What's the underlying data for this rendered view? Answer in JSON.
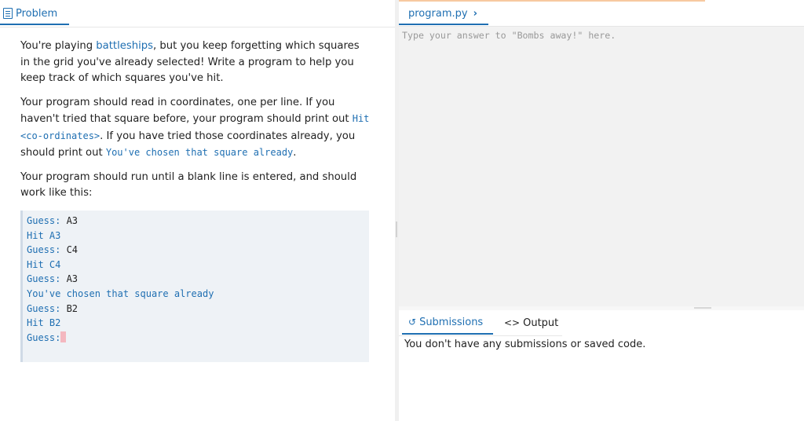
{
  "problem_tab": {
    "label": "Problem",
    "icon": "document-icon"
  },
  "problem": {
    "p1_before": "You're playing ",
    "p1_link": "battleships",
    "p1_after": ", but you keep forgetting which squares in the grid you've already selected! Write a program to help you keep track of which squares you've hit.",
    "p2_part1": "Your program should read in coordinates, one per line. If you haven't tried that square before, your program should print out ",
    "p2_code1": "Hit <co-ordinates>",
    "p2_part2": ". If you have tried those coordinates already, you should print out ",
    "p2_code2": "You've chosen that square already",
    "p2_part3": ".",
    "p3": "Your program should run until a blank line is entered, and should work like this:"
  },
  "sample_lines": [
    {
      "prompt": "Guess: ",
      "input": "A3"
    },
    {
      "prompt": "Hit A3",
      "input": ""
    },
    {
      "prompt": "Guess: ",
      "input": "C4"
    },
    {
      "prompt": "Hit C4",
      "input": ""
    },
    {
      "prompt": "Guess: ",
      "input": "A3"
    },
    {
      "prompt": "You've chosen that square already",
      "input": ""
    },
    {
      "prompt": "Guess: ",
      "input": "B2"
    },
    {
      "prompt": "Hit B2",
      "input": ""
    },
    {
      "prompt": "Guess:",
      "input": ""
    }
  ],
  "editor": {
    "tab_label": "program.py",
    "tab_chevron": "›",
    "placeholder": "Type your answer to \"Bombs away!\" here."
  },
  "bottom": {
    "submissions_label": "Submissions",
    "submissions_icon": "↺",
    "output_label": "Output",
    "output_icon": "<>",
    "message": "You don't have any submissions or saved code."
  },
  "colors": {
    "accent": "#1f6fb2",
    "code_bg": "#eef2f6",
    "editor_bg": "#f2f2f2"
  }
}
